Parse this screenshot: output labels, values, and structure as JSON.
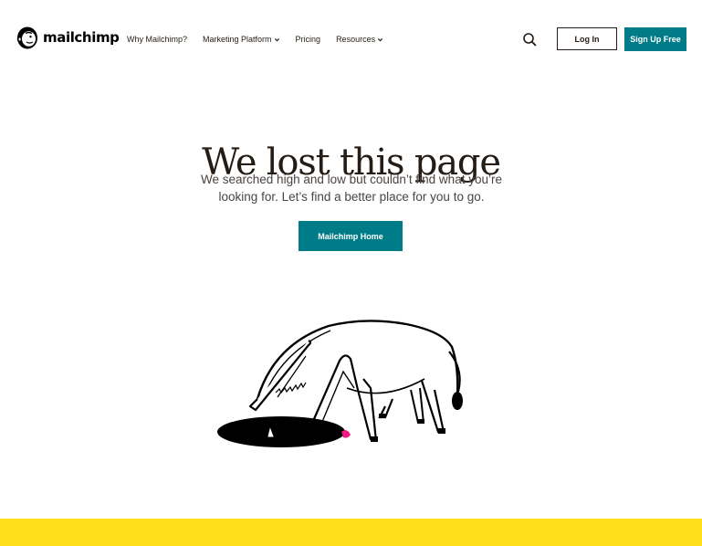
{
  "header": {
    "logo_text": "mailchimp",
    "nav": {
      "why": "Why Mailchimp?",
      "marketing": "Marketing Platform",
      "pricing": "Pricing",
      "resources": "Resources"
    },
    "login_label": "Log In",
    "signup_label": "Sign Up Free"
  },
  "hero": {
    "title": "We lost this page",
    "subtext": "We searched high and low but couldn’t find what you’re looking for. Let’s find a better place for you to go.",
    "home_button": "Mailchimp Home"
  },
  "colors": {
    "brand_teal": "#007c89",
    "brand_yellow": "#ffe01b",
    "ink": "#241c15"
  },
  "icons": {
    "logo": "mailchimp-freddie-icon",
    "search": "search-icon",
    "caret": "chevron-down-icon",
    "illustration": "horse-in-hole-illustration"
  }
}
